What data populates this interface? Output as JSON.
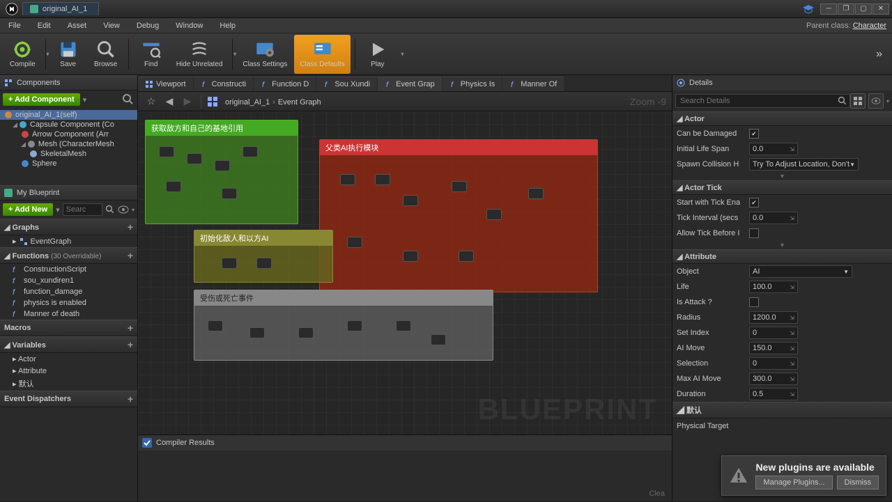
{
  "window": {
    "title": "original_AI_1"
  },
  "menu": {
    "items": [
      "File",
      "Edit",
      "Asset",
      "View",
      "Debug",
      "Window",
      "Help"
    ],
    "parentClassLabel": "Parent class:",
    "parentClass": "Character"
  },
  "toolbar": {
    "compile": "Compile",
    "save": "Save",
    "browse": "Browse",
    "find": "Find",
    "hideUnrelated": "Hide Unrelated",
    "classSettings": "Class Settings",
    "classDefaults": "Class Defaults",
    "play": "Play"
  },
  "components": {
    "title": "Components",
    "addBtn": "+ Add Component",
    "tree": [
      {
        "label": "original_AI_1(self)",
        "indent": 0,
        "sel": true,
        "icon": "cube"
      },
      {
        "label": "Capsule Component (Co",
        "indent": 1,
        "icon": "capsule",
        "exp": true
      },
      {
        "label": "Arrow Component (Arr",
        "indent": 2,
        "icon": "arrow"
      },
      {
        "label": "Mesh (CharacterMesh",
        "indent": 2,
        "icon": "mesh",
        "exp": true
      },
      {
        "label": "SkeletalMesh",
        "indent": 3,
        "icon": "skel"
      },
      {
        "label": "Sphere",
        "indent": 2,
        "icon": "sphere"
      }
    ]
  },
  "myBlueprint": {
    "title": "My Blueprint",
    "addBtn": "+ Add New",
    "searchPlaceholder": "Searc",
    "graphs": {
      "hdr": "Graphs",
      "items": [
        "EventGraph"
      ]
    },
    "functions": {
      "hdr": "Functions",
      "sub": "(30 Overridable)",
      "items": [
        "ConstructionScript",
        "sou_xundiren1",
        "function_damage",
        "physics is enabled",
        "Manner of death"
      ]
    },
    "macros": {
      "hdr": "Macros",
      "items": []
    },
    "variables": {
      "hdr": "Variables",
      "items": [
        "Actor",
        "Attribute",
        "默认"
      ]
    },
    "dispatchers": {
      "hdr": "Event Dispatchers",
      "items": []
    }
  },
  "editorTabs": [
    "Viewport",
    "Constructi",
    "Function D",
    "Sou Xundi",
    "Event Grap",
    "Physics Is",
    "Manner Of"
  ],
  "activeTab": 4,
  "breadcrumb": {
    "root": "original_AI_1",
    "leaf": "Event Graph"
  },
  "zoom": "Zoom -9",
  "comments": {
    "c1": "获取敌方和自己的基地引用",
    "c2": "父类AI执行模块",
    "c3": "初始化敌人和以方AI",
    "c4": "受伤或死亡事件"
  },
  "watermark": "BLUEPRINT",
  "compiler": {
    "title": "Compiler Results",
    "clear": "Clea"
  },
  "details": {
    "title": "Details",
    "searchPlaceholder": "Search Details",
    "groups": [
      {
        "name": "Actor",
        "props": [
          {
            "label": "Can be Damaged",
            "type": "check",
            "value": true
          },
          {
            "label": "Initial Life Span",
            "type": "num",
            "value": "0.0"
          },
          {
            "label": "Spawn Collision H",
            "type": "dd",
            "value": "Try To Adjust Location, Don't"
          }
        ]
      },
      {
        "name": "Actor Tick",
        "props": [
          {
            "label": "Start with Tick Ena",
            "type": "check",
            "value": true
          },
          {
            "label": "Tick Interval (secs",
            "type": "num",
            "value": "0.0"
          },
          {
            "label": "Allow Tick Before I",
            "type": "check",
            "value": false
          }
        ]
      },
      {
        "name": "Attribute",
        "props": [
          {
            "label": "Object",
            "type": "dd",
            "value": "AI"
          },
          {
            "label": "Life",
            "type": "num",
            "value": "100.0"
          },
          {
            "label": "Is Attack ?",
            "type": "check",
            "value": false
          },
          {
            "label": "Radius",
            "type": "num",
            "value": "1200.0"
          },
          {
            "label": "Set Index",
            "type": "num",
            "value": "0"
          },
          {
            "label": "AI Move",
            "type": "num",
            "value": "150.0"
          },
          {
            "label": "Selection",
            "type": "num",
            "value": "0"
          },
          {
            "label": "Max AI Move",
            "type": "num",
            "value": "300.0"
          },
          {
            "label": "Duration",
            "type": "num",
            "value": "0.5"
          }
        ]
      },
      {
        "name": "默认",
        "props": [
          {
            "label": "Physical Target",
            "type": "label",
            "value": ""
          }
        ]
      }
    ]
  },
  "notification": {
    "text": "New plugins are available",
    "manage": "Manage Plugins...",
    "dismiss": "Dismiss"
  }
}
